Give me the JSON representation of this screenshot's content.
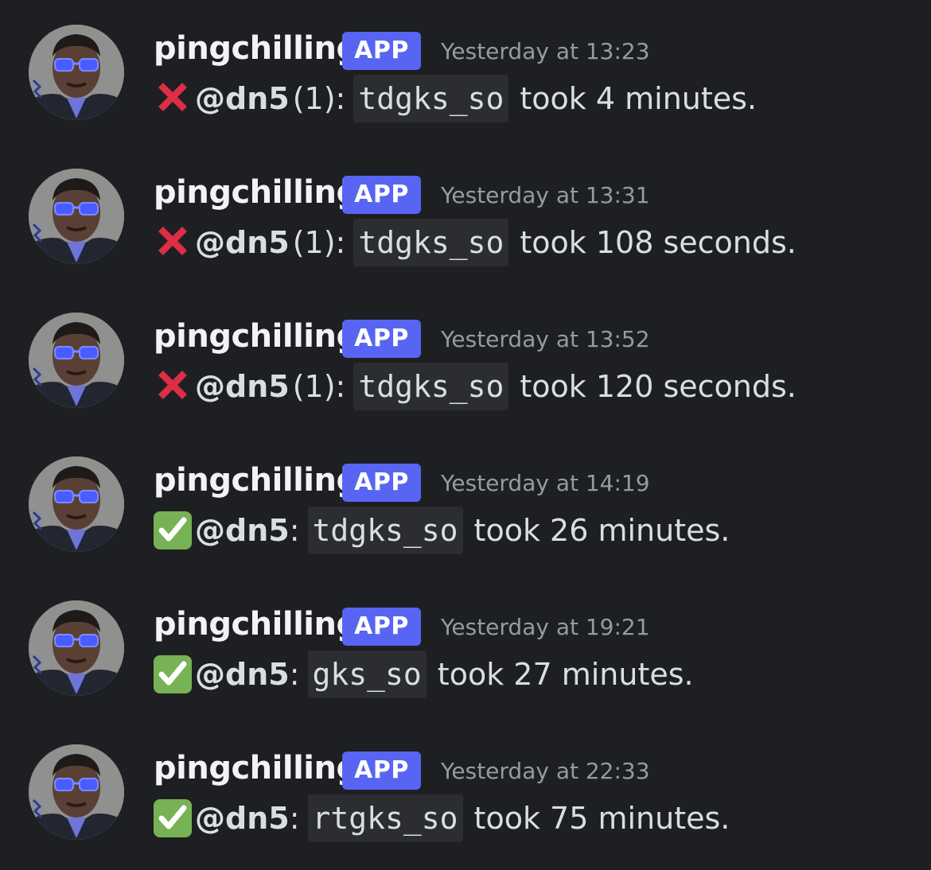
{
  "messages": [
    {
      "username": "pingchilling",
      "badge": "APP",
      "timestamp": "Yesterday at 13:23",
      "status": "fail",
      "mention": "@dn5",
      "attempt": "(1)",
      "colon": ":",
      "code": "tdgks_so",
      "tail": "took 4 minutes."
    },
    {
      "username": "pingchilling",
      "badge": "APP",
      "timestamp": "Yesterday at 13:31",
      "status": "fail",
      "mention": "@dn5",
      "attempt": "(1)",
      "colon": ":",
      "code": "tdgks_so",
      "tail": "took 108 seconds."
    },
    {
      "username": "pingchilling",
      "badge": "APP",
      "timestamp": "Yesterday at 13:52",
      "status": "fail",
      "mention": "@dn5",
      "attempt": "(1)",
      "colon": ":",
      "code": "tdgks_so",
      "tail": "took 120 seconds."
    },
    {
      "username": "pingchilling",
      "badge": "APP",
      "timestamp": "Yesterday at 14:19",
      "status": "success",
      "mention": "@dn5",
      "attempt": "",
      "colon": ":",
      "code": "tdgks_so",
      "tail": "took 26 minutes."
    },
    {
      "username": "pingchilling",
      "badge": "APP",
      "timestamp": "Yesterday at 19:21",
      "status": "success",
      "mention": "@dn5",
      "attempt": "",
      "colon": ":",
      "code": "gks_so",
      "tail": "took 27 minutes."
    },
    {
      "username": "pingchilling",
      "badge": "APP",
      "timestamp": "Yesterday at 22:33",
      "status": "success",
      "mention": "@dn5",
      "attempt": "",
      "colon": ":",
      "code": "rtgks_so",
      "tail": "took 75 minutes."
    }
  ],
  "colors": {
    "background": "#1e1f22",
    "badge": "#5865f2",
    "fail": "#dd2e44",
    "success": "#77b255",
    "timestamp": "#949ba4"
  },
  "icons": {
    "fail": "cross-mark-icon",
    "success": "check-mark-button-icon",
    "avatar": "user-avatar"
  }
}
